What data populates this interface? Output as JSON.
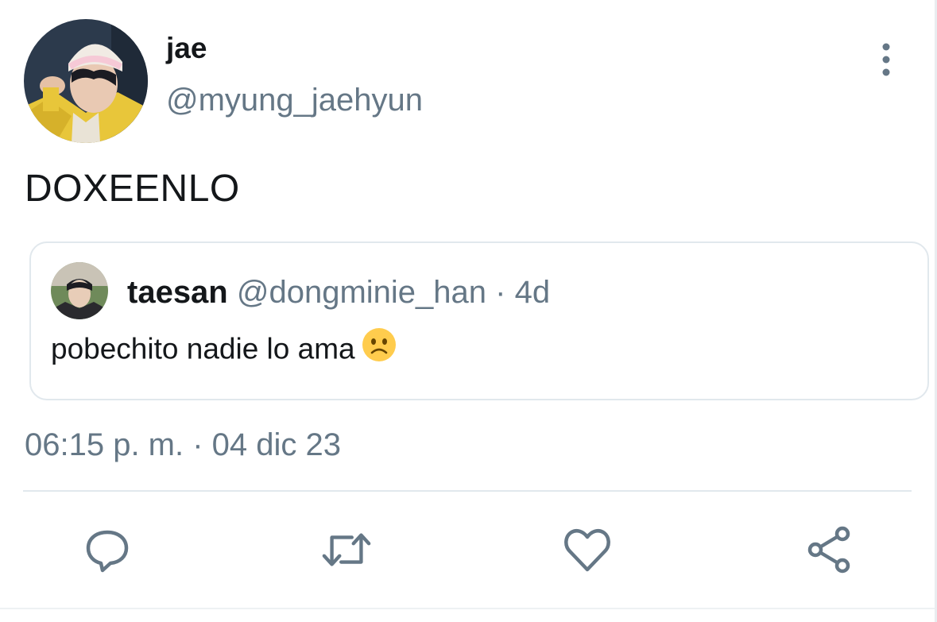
{
  "tweet": {
    "author": {
      "display_name": "jae",
      "handle": "@myung_jaehyun"
    },
    "text": "DOXEENLO",
    "timestamp": "06:15 p. m. · 04 dic 23",
    "quoted": {
      "display_name": "taesan",
      "handle": "@dongminie_han",
      "separator": " · ",
      "age": "4d",
      "text": "pobechito nadie lo ama",
      "emoji": "slightly-frowning-face"
    }
  },
  "icons": {
    "more": "more-vertical-icon",
    "reply": "reply-icon",
    "retweet": "retweet-icon",
    "like": "heart-icon",
    "share": "share-icon"
  },
  "colors": {
    "primary_text": "#14171a",
    "secondary_text": "#657786",
    "border": "#e1e8ed",
    "emoji_fill": "#ffcc4d"
  }
}
